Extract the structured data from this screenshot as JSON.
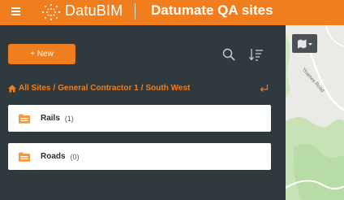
{
  "header": {
    "brand": "DatuBIM",
    "title": "Datumate QA sites"
  },
  "toolbar": {
    "new_label": "+ New"
  },
  "breadcrumb": {
    "items": [
      "All Sites",
      "General Contractor 1",
      "South West"
    ],
    "separator": "/"
  },
  "folders": [
    {
      "name": "Rails",
      "count": "(1)"
    },
    {
      "name": "Roads",
      "count": "(0)"
    }
  ],
  "map": {
    "road_label": "Thames Road"
  },
  "colors": {
    "accent": "#f07d1e",
    "panel": "#2f3a3f",
    "map": "#eaeae6"
  }
}
